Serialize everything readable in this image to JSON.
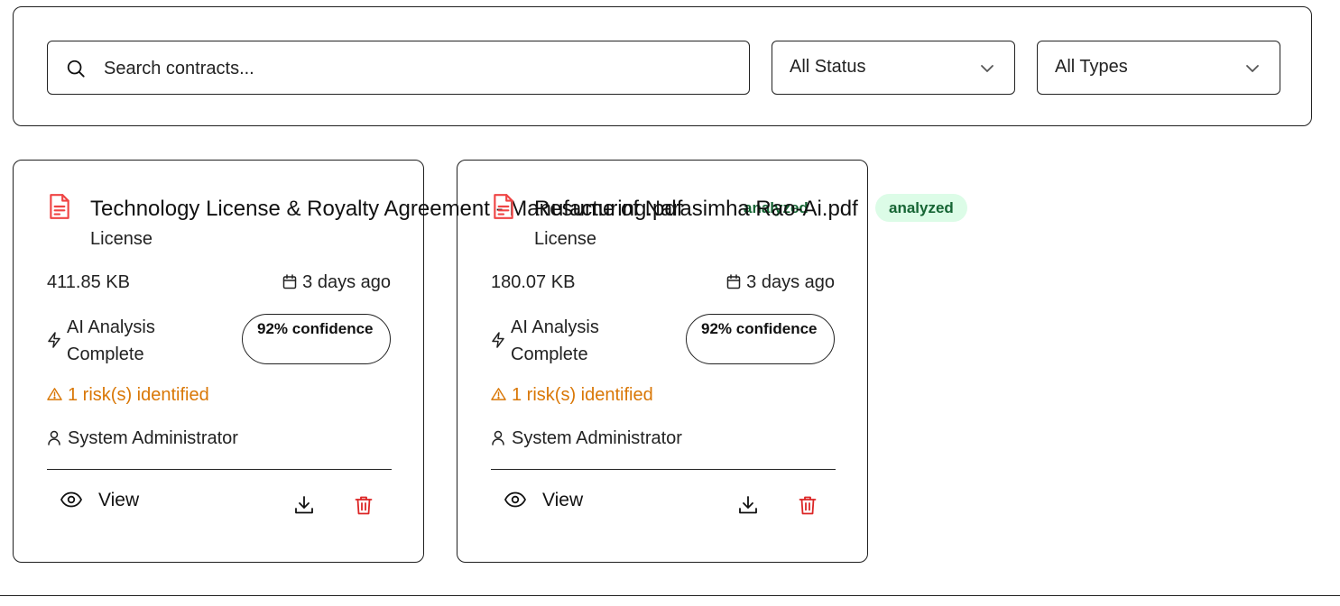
{
  "search": {
    "placeholder": "Search contracts..."
  },
  "filters": {
    "status_label": "All Status",
    "types_label": "All Types"
  },
  "colors": {
    "risk": "#d97706",
    "badge_bg": "#dcfce7",
    "badge_text": "#166534",
    "danger": "#dc2626",
    "file_icon": "#ef4444"
  },
  "contracts": [
    {
      "title": "Technology License & Royalty Agreement - Manufacturing.pdf",
      "status": "analyzed",
      "type": "License",
      "size": "411.85 KB",
      "date": "3 days ago",
      "ai_status": "AI Analysis Complete",
      "confidence": "92% confidence",
      "risk": "1 risk(s) identified",
      "owner": "System Administrator",
      "view_label": "View"
    },
    {
      "title": "Resume of Narasimha Rao-Ai.pdf",
      "status": "analyzed",
      "type": "License",
      "size": "180.07 KB",
      "date": "3 days ago",
      "ai_status": "AI Analysis Complete",
      "confidence": "92% confidence",
      "risk": "1 risk(s) identified",
      "owner": "System Administrator",
      "view_label": "View"
    }
  ]
}
